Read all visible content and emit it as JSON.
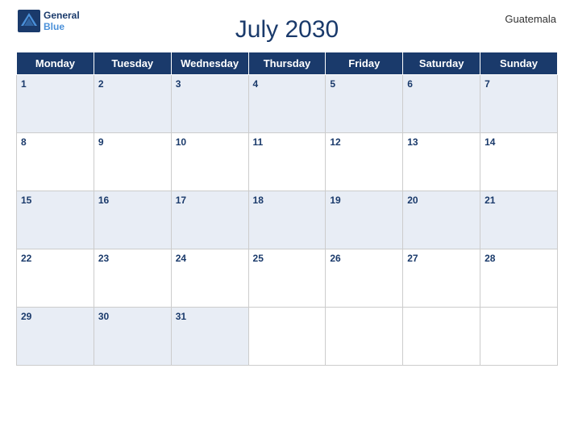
{
  "logo": {
    "line1": "General",
    "line2": "Blue"
  },
  "country": "Guatemala",
  "title": "July 2030",
  "headers": [
    "Monday",
    "Tuesday",
    "Wednesday",
    "Thursday",
    "Friday",
    "Saturday",
    "Sunday"
  ],
  "weeks": [
    [
      "1",
      "2",
      "3",
      "4",
      "5",
      "6",
      "7"
    ],
    [
      "8",
      "9",
      "10",
      "11",
      "12",
      "13",
      "14"
    ],
    [
      "15",
      "16",
      "17",
      "18",
      "19",
      "20",
      "21"
    ],
    [
      "22",
      "23",
      "24",
      "25",
      "26",
      "27",
      "28"
    ],
    [
      "29",
      "30",
      "31",
      "",
      "",
      "",
      ""
    ]
  ]
}
